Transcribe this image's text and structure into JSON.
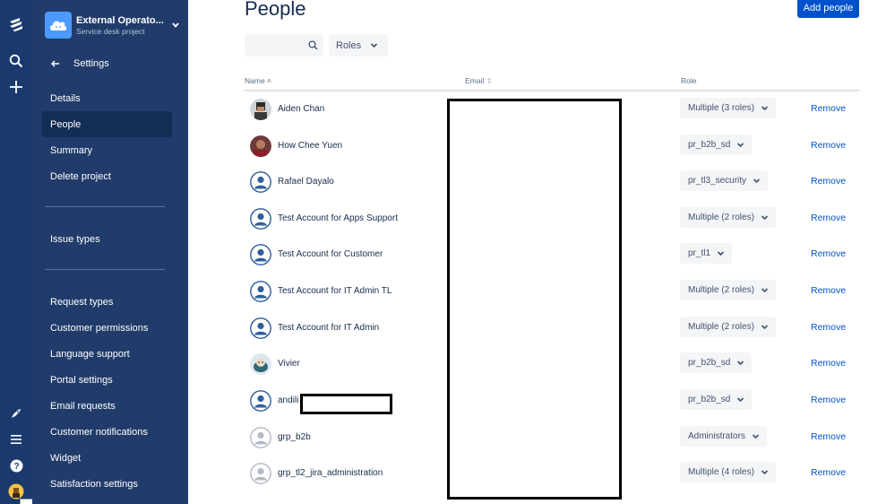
{
  "colors": {
    "accent": "#0052cc",
    "sidebar": "#213c6b",
    "global_nav": "#1a3a6e",
    "active_item": "#142d55"
  },
  "global_nav": {
    "icons": [
      "jira-logo-icon",
      "search-icon",
      "create-plus-icon",
      "feedback-rocket-icon",
      "menu-icon",
      "help-icon",
      "profile-avatar-icon"
    ]
  },
  "project": {
    "name": "External Operato...",
    "type": "Service desk project"
  },
  "sidebar": {
    "back_label": "Settings",
    "items": [
      {
        "label": "Details"
      },
      {
        "label": "People"
      },
      {
        "label": "Summary"
      },
      {
        "label": "Delete project"
      },
      {
        "label": "Issue types"
      },
      {
        "label": "Request types"
      },
      {
        "label": "Customer permissions"
      },
      {
        "label": "Language support"
      },
      {
        "label": "Portal settings"
      },
      {
        "label": "Email requests"
      },
      {
        "label": "Customer notifications"
      },
      {
        "label": "Widget"
      },
      {
        "label": "Satisfaction settings"
      }
    ],
    "active": "People"
  },
  "page": {
    "title": "People",
    "add_button": "Add people",
    "search_placeholder": "",
    "roles_filter": "Roles"
  },
  "table": {
    "headers": {
      "name": "Name",
      "email": "Email",
      "role": "Role"
    },
    "remove_label": "Remove",
    "rows": [
      {
        "name": "Aiden Chan",
        "role": "Multiple (3 roles)",
        "avatar": "photo-avatar"
      },
      {
        "name": "How Chee Yuen",
        "role": "pr_b2b_sd",
        "avatar": "photo-avatar"
      },
      {
        "name": "Rafael Dayalo",
        "role": "pr_tl3_security",
        "avatar": "default-user-avatar"
      },
      {
        "name": "Test Account for Apps Support",
        "role": "Multiple (2 roles)",
        "avatar": "default-user-avatar"
      },
      {
        "name": "Test Account for Customer",
        "role": "pr_tl1",
        "avatar": "default-user-avatar"
      },
      {
        "name": "Test Account for IT Admin TL",
        "role": "Multiple (2 roles)",
        "avatar": "default-user-avatar"
      },
      {
        "name": "Test Account for IT Admin",
        "role": "Multiple (2 roles)",
        "avatar": "default-user-avatar"
      },
      {
        "name": "Vivier",
        "role": "pr_b2b_sd",
        "avatar": "photo-avatar"
      },
      {
        "name": "andili",
        "role": "pr_b2b_sd",
        "avatar": "default-user-avatar"
      },
      {
        "name": "grp_b2b",
        "role": "Administrators",
        "avatar": "group-avatar"
      },
      {
        "name": "grp_tl2_jira_administration",
        "role": "Multiple (4 roles)",
        "avatar": "group-avatar"
      }
    ]
  }
}
